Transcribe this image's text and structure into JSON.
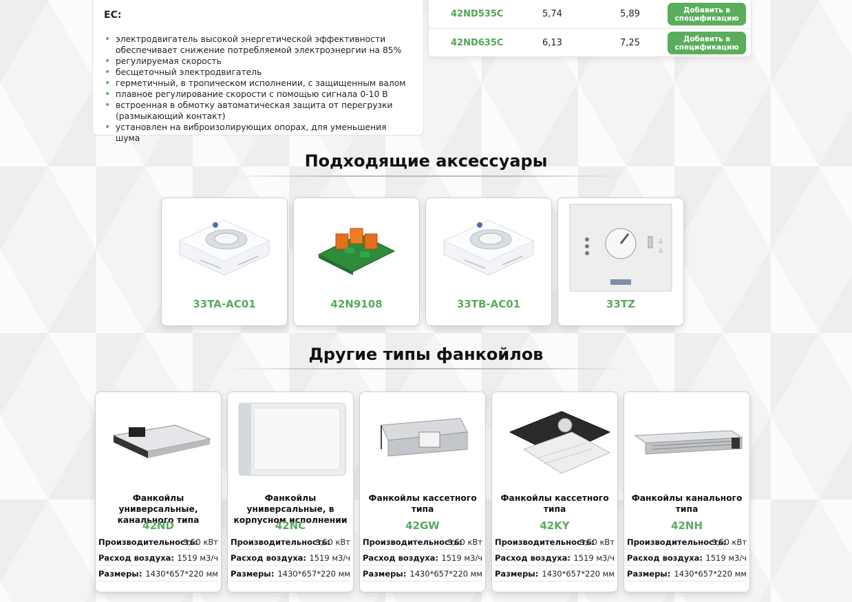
{
  "features": {
    "title": "EC:",
    "items": [
      "электродвигатель высокой энергетической эффективности обеспечивает снижение потребляемой электроэнергии на 85%",
      "регулируемая скорость",
      "бесщеточный электродвигатель",
      "герметичный, в тропическом исполнении, с защищенным валом",
      "плавное регулирование скорости с помощью сигнала 0-10 В",
      "встроенная в обмотку автоматическая защита от перегрузки (размыкающий контакт)",
      "установлен на виброизолирующих опорах, для уменьшения шума"
    ]
  },
  "models": {
    "rows": [
      {
        "name": "42ND535C",
        "v1": "5,74",
        "v2": "5,89",
        "button": "Добавить в спецификацию"
      },
      {
        "name": "42ND635C",
        "v1": "6,13",
        "v2": "7,25",
        "button": "Добавить в спецификацию"
      }
    ]
  },
  "accessories": {
    "title": "Подходящие аксессуары",
    "items": [
      {
        "name": "33TA-AC01",
        "icon": "thermostat-controller-image"
      },
      {
        "name": "42N9108",
        "icon": "relay-board-image"
      },
      {
        "name": "33TB-AC01",
        "icon": "thermostat-controller-image"
      },
      {
        "name": "33TZ",
        "icon": "wall-thermostat-image"
      }
    ]
  },
  "other_types": {
    "title": "Другие типы фанкойлов",
    "spec_labels": {
      "capacity": "Производительность:",
      "airflow": "Расход воздуха:",
      "size": "Размеры:"
    },
    "items": [
      {
        "title": "Фанкойлы универсальные, канального типа",
        "model": "42ND",
        "capacity": "9,50 кВт",
        "airflow": "1519 м3/ч",
        "size": "1430*657*220 мм"
      },
      {
        "title": "Фанкойлы универсальные, в корпусном исполнении",
        "model": "42NC",
        "capacity": "9,50 кВт",
        "airflow": "1519 м3/ч",
        "size": "1430*657*220 мм"
      },
      {
        "title": "Фанкойлы кассетного типа",
        "model": "42GW",
        "capacity": "9,50 кВт",
        "airflow": "1519 м3/ч",
        "size": "1430*657*220 мм"
      },
      {
        "title": "Фанкойлы кассетного типа",
        "model": "42KY",
        "capacity": "9,50 кВт",
        "airflow": "1519 м3/ч",
        "size": "1430*657*220 мм"
      },
      {
        "title": "Фанкойлы канального типа",
        "model": "42NH",
        "capacity": "9,50 кВт",
        "airflow": "1519 м3/ч",
        "size": "1430*657*220 мм"
      }
    ]
  },
  "colors": {
    "accent": "#5aae5b",
    "accent_text": "#4ea654"
  }
}
